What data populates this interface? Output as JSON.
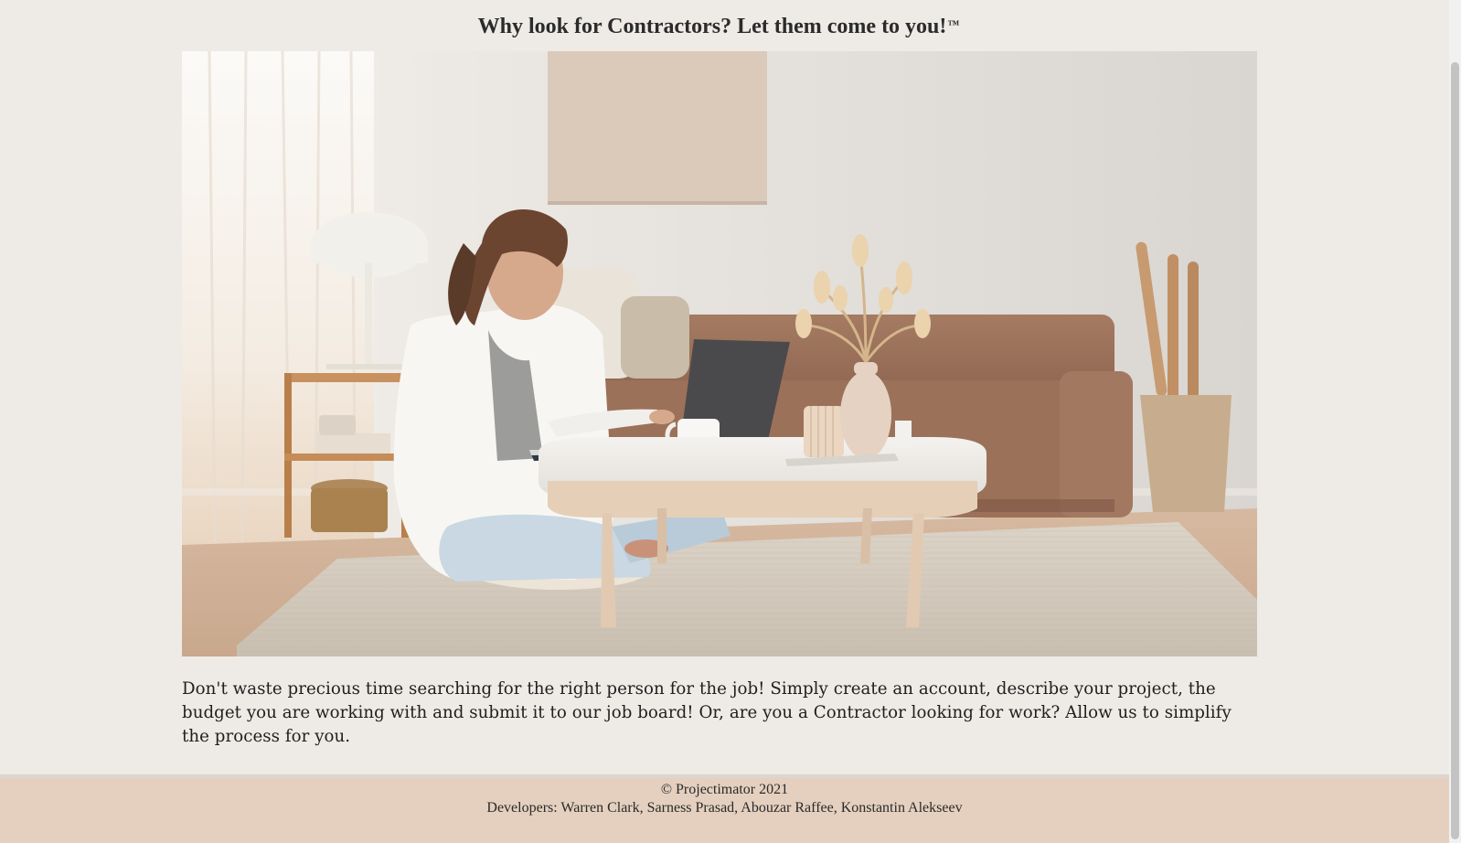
{
  "header": {
    "headline": "Why look for Contractors? Let them come to you!",
    "trademark": "™"
  },
  "hero": {
    "alt": "Woman working on a laptop at a coffee table in a cozy living room"
  },
  "intro": {
    "text": "Don't waste precious time searching for the right person for the job! Simply create an account, describe your project, the budget you are working with and submit it to our job board! Or, are you a Contractor looking for work? Allow us to simplify the process for you."
  },
  "footer": {
    "copyright": "© Projectimator 2021",
    "developers": "Developers: Warren Clark, Sarness Prasad, Abouzar Raffee, Konstantin Alekseev"
  },
  "colors": {
    "page_background": "#eeebe6",
    "footer_background": "#e5d0bf"
  }
}
